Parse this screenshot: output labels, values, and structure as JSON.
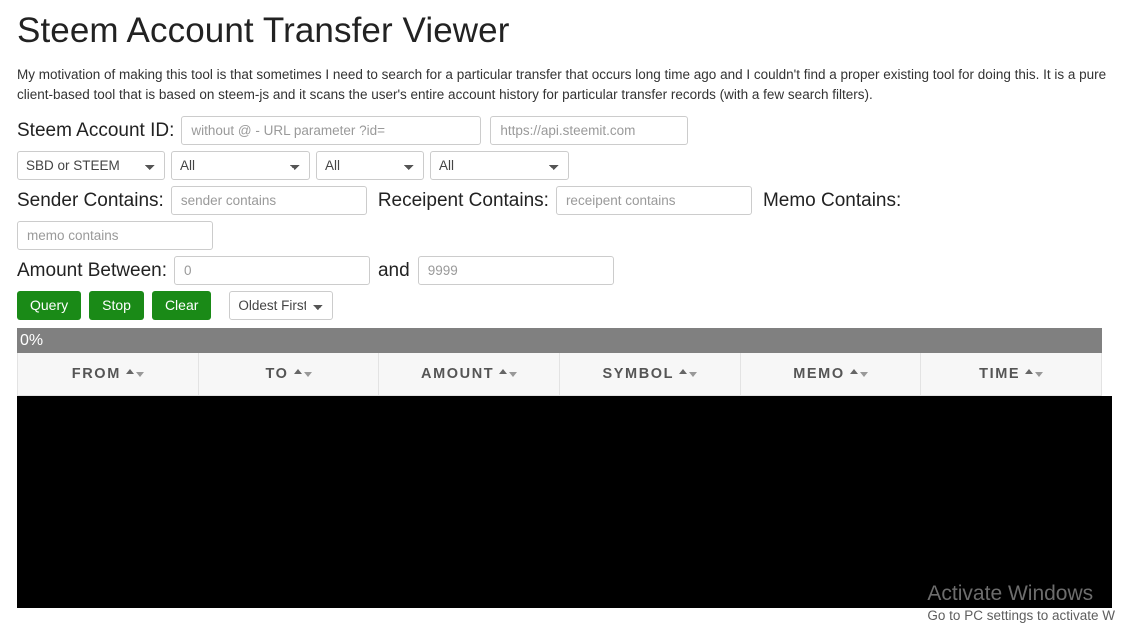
{
  "page": {
    "title": "Steem Account Transfer Viewer",
    "intro": "My motivation of making this tool is that sometimes I need to search for a particular transfer that occurs long time ago and I couldn't find a proper existing tool for doing this. It is a pure client-based tool that is based on steem-js and it scans the user's entire account history for particular transfer records (with a few search filters)."
  },
  "form": {
    "account_label": "Steem Account ID:",
    "account_placeholder": "without @ - URL parameter ?id=",
    "account_value": "",
    "api_placeholder": "https://api.steemit.com",
    "api_value": "",
    "currency_selected": "SBD or STEEM",
    "filter1_selected": "All",
    "filter2_selected": "All",
    "filter3_selected": "All",
    "sender_label": "Sender Contains:",
    "sender_placeholder": "sender contains",
    "sender_value": "",
    "recipient_label": "Receipent Contains:",
    "recipient_placeholder": "receipent contains",
    "recipient_value": "",
    "memo_label": "Memo Contains:",
    "memo_placeholder": "memo contains",
    "memo_value": "",
    "amount_label": "Amount Between:",
    "amount_min_placeholder": "0",
    "amount_min_value": "",
    "amount_and_label": "and",
    "amount_max_placeholder": "9999",
    "amount_max_value": "",
    "order_selected": "Oldest First"
  },
  "buttons": {
    "query": "Query",
    "stop": "Stop",
    "clear": "Clear"
  },
  "progress": {
    "percent_label": "0%",
    "percent_value": 0,
    "bar_color": "#808080",
    "text_color": "#ffffff"
  },
  "results": {
    "columns": [
      {
        "label": "FROM"
      },
      {
        "label": "TO"
      },
      {
        "label": "AMOUNT"
      },
      {
        "label": "SYMBOL"
      },
      {
        "label": "MEMO"
      },
      {
        "label": "TIME"
      }
    ],
    "rows": [],
    "body_background": "#000000"
  },
  "watermark": {
    "line1": "Activate Windows",
    "line2": "Go to PC settings to activate W"
  },
  "colors": {
    "button_green": "#1a8a17",
    "progress_gray": "#808080",
    "header_bg": "#f7f7f7"
  }
}
